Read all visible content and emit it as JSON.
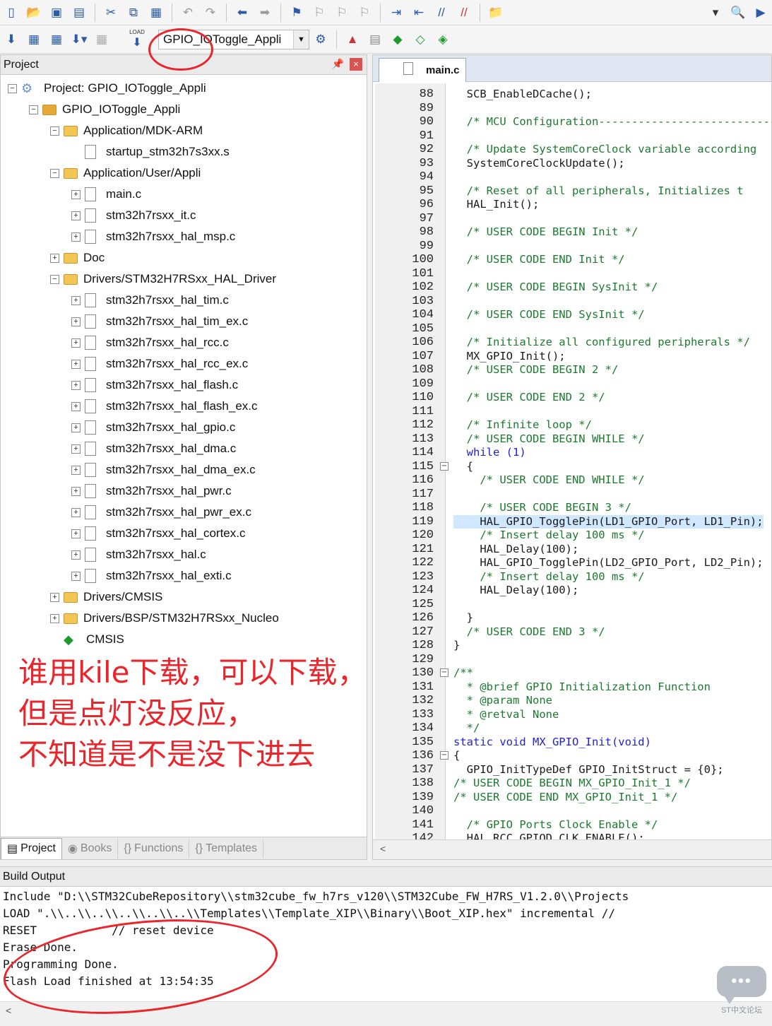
{
  "toolbar2": {
    "target_name": "GPIO_IOToggle_Appli",
    "load_label": "LOAD"
  },
  "project_panel": {
    "title": "Project",
    "tree": [
      {
        "label": "Project: GPIO_IOToggle_Appli",
        "kind": "project",
        "expander": "−"
      },
      {
        "label": "GPIO_IOToggle_Appli",
        "kind": "target",
        "expander": "−"
      },
      {
        "label": "Application/MDK-ARM",
        "kind": "folder",
        "expander": "−"
      },
      {
        "label": "startup_stm32h7s3xx.s",
        "kind": "file",
        "expander": ""
      },
      {
        "label": "Application/User/Appli",
        "kind": "folder",
        "expander": "−"
      },
      {
        "label": "main.c",
        "kind": "file",
        "expander": "+"
      },
      {
        "label": "stm32h7rsxx_it.c",
        "kind": "file",
        "expander": "+"
      },
      {
        "label": "stm32h7rsxx_hal_msp.c",
        "kind": "file",
        "expander": "+"
      },
      {
        "label": "Doc",
        "kind": "folder",
        "expander": "+"
      },
      {
        "label": "Drivers/STM32H7RSxx_HAL_Driver",
        "kind": "folder",
        "expander": "−"
      },
      {
        "label": "stm32h7rsxx_hal_tim.c",
        "kind": "file",
        "expander": "+"
      },
      {
        "label": "stm32h7rsxx_hal_tim_ex.c",
        "kind": "file",
        "expander": "+"
      },
      {
        "label": "stm32h7rsxx_hal_rcc.c",
        "kind": "file",
        "expander": "+"
      },
      {
        "label": "stm32h7rsxx_hal_rcc_ex.c",
        "kind": "file",
        "expander": "+"
      },
      {
        "label": "stm32h7rsxx_hal_flash.c",
        "kind": "file",
        "expander": "+"
      },
      {
        "label": "stm32h7rsxx_hal_flash_ex.c",
        "kind": "file",
        "expander": "+"
      },
      {
        "label": "stm32h7rsxx_hal_gpio.c",
        "kind": "file",
        "expander": "+"
      },
      {
        "label": "stm32h7rsxx_hal_dma.c",
        "kind": "file",
        "expander": "+"
      },
      {
        "label": "stm32h7rsxx_hal_dma_ex.c",
        "kind": "file",
        "expander": "+"
      },
      {
        "label": "stm32h7rsxx_hal_pwr.c",
        "kind": "file",
        "expander": "+"
      },
      {
        "label": "stm32h7rsxx_hal_pwr_ex.c",
        "kind": "file",
        "expander": "+"
      },
      {
        "label": "stm32h7rsxx_hal_cortex.c",
        "kind": "file",
        "expander": "+"
      },
      {
        "label": "stm32h7rsxx_hal.c",
        "kind": "file",
        "expander": "+"
      },
      {
        "label": "stm32h7rsxx_hal_exti.c",
        "kind": "file",
        "expander": "+"
      },
      {
        "label": "Drivers/CMSIS",
        "kind": "folder",
        "expander": "+"
      },
      {
        "label": "Drivers/BSP/STM32H7RSxx_Nucleo",
        "kind": "folder",
        "expander": "+"
      },
      {
        "label": "CMSIS",
        "kind": "cmsis",
        "expander": ""
      }
    ],
    "tabs": [
      "Project",
      "Books",
      "Functions",
      "Templates"
    ]
  },
  "editor": {
    "tab_label": "main.c",
    "lines": [
      {
        "n": "88",
        "t": "  SCB_EnableDCache();",
        "s": ""
      },
      {
        "n": "89",
        "t": "",
        "s": ""
      },
      {
        "n": "90",
        "t": "  /* MCU Configuration--------------------------------------------------------*/",
        "s": "c"
      },
      {
        "n": "91",
        "t": "",
        "s": ""
      },
      {
        "n": "92",
        "t": "  /* Update SystemCoreClock variable according",
        "s": "c"
      },
      {
        "n": "93",
        "t": "  SystemCoreClockUpdate();",
        "s": ""
      },
      {
        "n": "94",
        "t": "",
        "s": ""
      },
      {
        "n": "95",
        "t": "  /* Reset of all peripherals, Initializes t",
        "s": "c"
      },
      {
        "n": "96",
        "t": "  HAL_Init();",
        "s": ""
      },
      {
        "n": "97",
        "t": "",
        "s": ""
      },
      {
        "n": "98",
        "t": "  /* USER CODE BEGIN Init */",
        "s": "c"
      },
      {
        "n": "99",
        "t": "",
        "s": ""
      },
      {
        "n": "100",
        "t": "  /* USER CODE END Init */",
        "s": "c"
      },
      {
        "n": "101",
        "t": "",
        "s": ""
      },
      {
        "n": "102",
        "t": "  /* USER CODE BEGIN SysInit */",
        "s": "c"
      },
      {
        "n": "103",
        "t": "",
        "s": ""
      },
      {
        "n": "104",
        "t": "  /* USER CODE END SysInit */",
        "s": "c"
      },
      {
        "n": "105",
        "t": "",
        "s": ""
      },
      {
        "n": "106",
        "t": "  /* Initialize all configured peripherals */",
        "s": "c"
      },
      {
        "n": "107",
        "t": "  MX_GPIO_Init();",
        "s": ""
      },
      {
        "n": "108",
        "t": "  /* USER CODE BEGIN 2 */",
        "s": "c"
      },
      {
        "n": "109",
        "t": "",
        "s": ""
      },
      {
        "n": "110",
        "t": "  /* USER CODE END 2 */",
        "s": "c"
      },
      {
        "n": "111",
        "t": "",
        "s": ""
      },
      {
        "n": "112",
        "t": "  /* Infinite loop */",
        "s": "c"
      },
      {
        "n": "113",
        "t": "  /* USER CODE BEGIN WHILE */",
        "s": "c"
      },
      {
        "n": "114",
        "t": "  while (1)",
        "s": "k"
      },
      {
        "n": "115",
        "t": "  {",
        "s": "",
        "fold": "−"
      },
      {
        "n": "116",
        "t": "    /* USER CODE END WHILE */",
        "s": "c"
      },
      {
        "n": "117",
        "t": "",
        "s": ""
      },
      {
        "n": "118",
        "t": "    /* USER CODE BEGIN 3 */",
        "s": "c"
      },
      {
        "n": "119",
        "t": "    HAL_GPIO_TogglePin(LD1_GPIO_Port, LD1_Pin);",
        "s": "",
        "hl": true
      },
      {
        "n": "120",
        "t": "    /* Insert delay 100 ms */",
        "s": "c"
      },
      {
        "n": "121",
        "t": "    HAL_Delay(100);",
        "s": ""
      },
      {
        "n": "122",
        "t": "    HAL_GPIO_TogglePin(LD2_GPIO_Port, LD2_Pin);",
        "s": ""
      },
      {
        "n": "123",
        "t": "    /* Insert delay 100 ms */",
        "s": "c"
      },
      {
        "n": "124",
        "t": "    HAL_Delay(100);",
        "s": ""
      },
      {
        "n": "125",
        "t": "",
        "s": ""
      },
      {
        "n": "126",
        "t": "  }",
        "s": ""
      },
      {
        "n": "127",
        "t": "  /* USER CODE END 3 */",
        "s": "c"
      },
      {
        "n": "128",
        "t": "}",
        "s": ""
      },
      {
        "n": "129",
        "t": "",
        "s": ""
      },
      {
        "n": "130",
        "t": "/**",
        "s": "c",
        "fold": "−"
      },
      {
        "n": "131",
        "t": "  * @brief GPIO Initialization Function",
        "s": "c"
      },
      {
        "n": "132",
        "t": "  * @param None",
        "s": "c"
      },
      {
        "n": "133",
        "t": "  * @retval None",
        "s": "c"
      },
      {
        "n": "134",
        "t": "  */",
        "s": "c"
      },
      {
        "n": "135",
        "t": "static void MX_GPIO_Init(void)",
        "s": "k"
      },
      {
        "n": "136",
        "t": "{",
        "s": "",
        "fold": "−"
      },
      {
        "n": "137",
        "t": "  GPIO_InitTypeDef GPIO_InitStruct = {0};",
        "s": ""
      },
      {
        "n": "138",
        "t": "/* USER CODE BEGIN MX_GPIO_Init_1 */",
        "s": "c"
      },
      {
        "n": "139",
        "t": "/* USER CODE END MX_GPIO_Init_1 */",
        "s": "c"
      },
      {
        "n": "140",
        "t": "",
        "s": ""
      },
      {
        "n": "141",
        "t": "  /* GPIO Ports Clock Enable */",
        "s": "c"
      },
      {
        "n": "142",
        "t": "  HAL_RCC_GPIOD_CLK_ENABLE();",
        "s": ""
      }
    ],
    "hscroll_arrow": "<"
  },
  "build_output": {
    "title": "Build Output",
    "lines": [
      "Include \"D:\\\\STM32CubeRepository\\\\stm32cube_fw_h7rs_v120\\\\STM32Cube_FW_H7RS_V1.2.0\\\\Projects",
      "LOAD \".\\\\..\\\\..\\\\..\\\\..\\\\..\\\\Templates\\\\Template_XIP\\\\Binary\\\\Boot_XIP.hex\" incremental //",
      "RESET           // reset device",
      "Erase Done.",
      "Programming Done.",
      "Flash Load finished at 13:54:35"
    ],
    "hscroll_arrow": "<"
  },
  "annotation": {
    "lines": [
      "谁用kile下载，可以下载，",
      "但是点灯没反应，",
      "不知道是不是没下进去"
    ],
    "color": "#e8262c"
  },
  "watermark": {
    "text": "ST中文论坛"
  }
}
